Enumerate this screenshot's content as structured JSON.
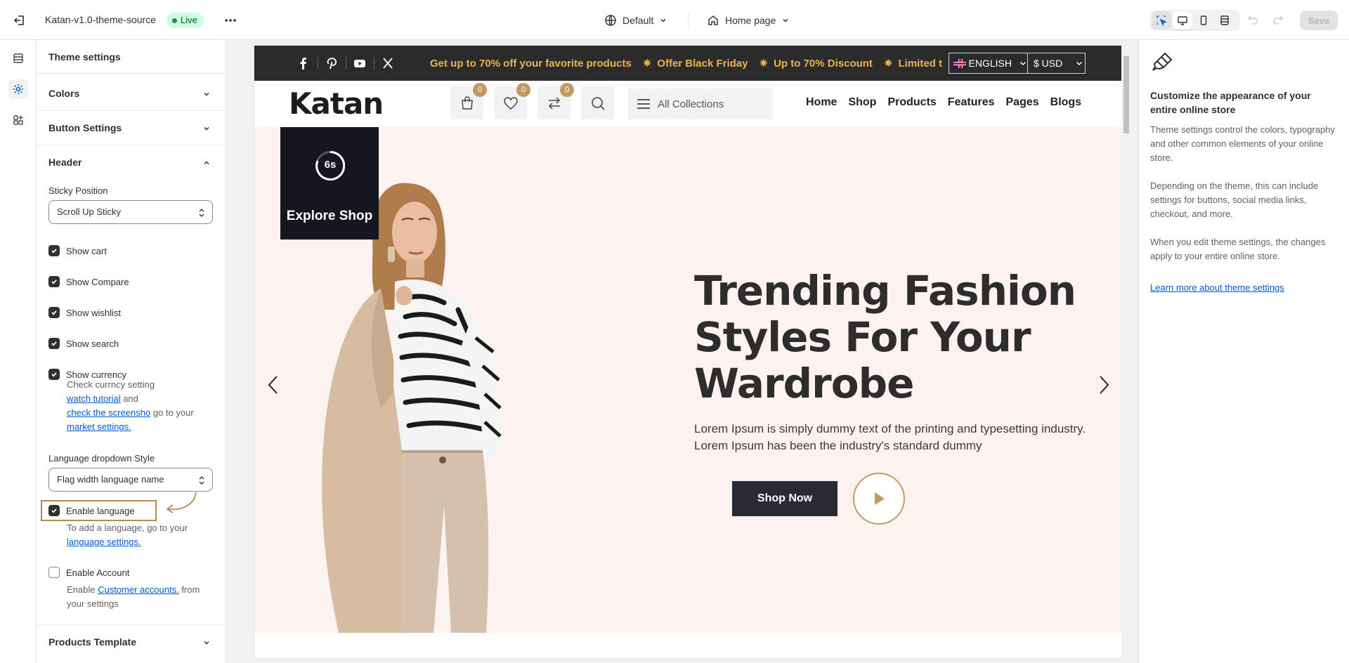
{
  "topbar": {
    "theme_name": "Katan-v1.0-theme-source",
    "status": "Live",
    "variant": "Default",
    "page": "Home page",
    "save_label": "Save"
  },
  "panel": {
    "title": "Theme settings",
    "sections": {
      "colors": "Colors",
      "button_settings": "Button Settings",
      "header": "Header",
      "products_template": "Products Template"
    },
    "sticky_label": "Sticky Position",
    "sticky_value": "Scroll Up Sticky",
    "checkboxes": {
      "show_cart": "Show cart",
      "show_compare": "Show Compare",
      "show_wishlist": "Show wishlist",
      "show_search": "Show search",
      "show_currency": "Show currency"
    },
    "currency_help": {
      "line1": "Check currncy setting",
      "link1": "watch tutorial",
      "and": " and",
      "link2": "check the screensho",
      "goto": " go to your",
      "link3": "market settings."
    },
    "lang_style_label": "Language dropdown Style",
    "lang_style_value": "Flag width language name",
    "enable_language": "Enable language",
    "language_help": {
      "text": "To add a language, go to your",
      "link": "language settings."
    },
    "enable_account": "Enable Account",
    "account_help": {
      "pre": "Enable ",
      "link": "Customer accounts.",
      "post": " from your settings"
    }
  },
  "store": {
    "promo_items": [
      "Get up to 70% off your favorite products",
      "Offer Black Friday",
      "Up to 70% Discount",
      "Limited time"
    ],
    "language": "ENGLISH",
    "currency": "$ USD",
    "logo": "Katan",
    "badges": {
      "cart": "0",
      "wishlist": "0",
      "compare": "0"
    },
    "collections": "All Collections",
    "menu": [
      "Home",
      "Shop",
      "Products",
      "Features",
      "Pages",
      "Blogs"
    ],
    "explore_timer": "6s",
    "explore_label": "Explore Shop",
    "hero_title": "Trending Fashion Styles For Your Wardrobe",
    "hero_desc": "Lorem Ipsum is simply dummy text of the printing and typesetting industry. Lorem Ipsum has been the industry's standard dummy",
    "shop_now": "Shop Now"
  },
  "info": {
    "title": "Customize the appearance of your entire online store",
    "p1": "Theme settings control the colors, typography and other common elements of your online store.",
    "p2": "Depending on the theme, this can include settings for buttons, social media links, checkout, and more.",
    "p3": "When you edit theme settings, the changes apply to your entire online store.",
    "link": "Learn more about theme settings"
  },
  "colors": {
    "accent_gold": "#c39a64",
    "live_bg": "#cdfee1",
    "link_blue": "#005bd3",
    "promo_text": "#e9b44c"
  }
}
